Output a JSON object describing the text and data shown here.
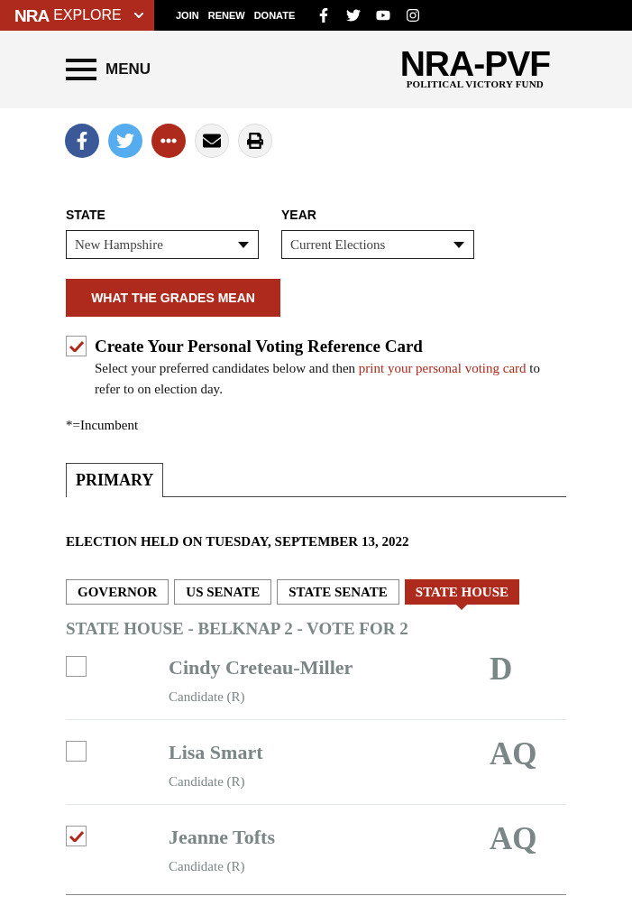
{
  "top_bar": {
    "logo": "NRA",
    "explore": "EXPLORE",
    "links": [
      "JOIN",
      "RENEW",
      "DONATE"
    ]
  },
  "header": {
    "menu": "MENU",
    "logo_title": "NRA-PVF",
    "logo_subtitle": "POLITICAL VICTORY FUND"
  },
  "filters": [
    {
      "label": "STATE",
      "value": "New Hampshire"
    },
    {
      "label": "YEAR",
      "value": "Current Elections"
    }
  ],
  "grades_button": "WHAT THE GRADES MEAN",
  "reference_card": {
    "checked": true,
    "title": "Create Your Personal Voting Reference Card",
    "text_before": "Select your preferred candidates below and then ",
    "link": "print your personal voting card",
    "text_after": " to refer to on election day."
  },
  "legend": "*=Incumbent",
  "election_tabs": [
    {
      "label": "PRIMARY",
      "selected": true
    }
  ],
  "election_date": "ELECTION HELD ON TUESDAY, SEPTEMBER 13, 2022",
  "race_tabs": [
    {
      "label": "GOVERNOR",
      "selected": false
    },
    {
      "label": "US SENATE",
      "selected": false
    },
    {
      "label": "STATE SENATE",
      "selected": false
    },
    {
      "label": "STATE HOUSE",
      "selected": true
    }
  ],
  "race_heading": "STATE HOUSE - BELKNAP 2 - VOTE FOR 2",
  "candidates": [
    {
      "name": "Cindy Creteau-Miller",
      "role": "Candidate (R)",
      "grade": "D",
      "checked": false
    },
    {
      "name": "Lisa Smart",
      "role": "Candidate (R)",
      "grade": "AQ",
      "checked": false
    },
    {
      "name": "Jeanne Tofts",
      "role": "Candidate (R)",
      "grade": "AQ",
      "checked": true
    }
  ]
}
